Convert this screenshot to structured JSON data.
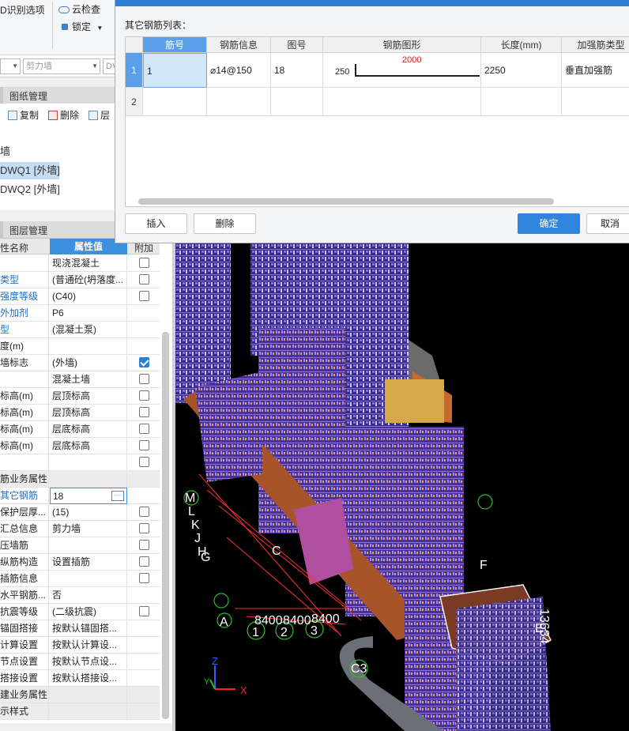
{
  "ribbon": {
    "recognize_label": "D识别选项",
    "cloud_check_label": "云检查",
    "lock_label": "锁定"
  },
  "combos": {
    "combo1_value": "",
    "combo2_value": "剪力墙",
    "combo3_value": "DV"
  },
  "drawing_panel": {
    "tab_label": "图纸管理",
    "toolbar": {
      "copy_label": "复制",
      "delete_label": "删除",
      "layer_label": "层"
    },
    "tree": [
      {
        "label": "墙",
        "selected": false
      },
      {
        "label": "DWQ1 [外墙]",
        "selected": true
      },
      {
        "label": "DWQ2 [外墙]",
        "selected": false
      }
    ]
  },
  "layer_panel": {
    "tab_label": "图层管理"
  },
  "properties": {
    "header": {
      "name_label": "性名称",
      "value_label": "属性值",
      "add_label": "附加"
    },
    "rows": [
      {
        "name": "",
        "value": "现浇混凝土",
        "blue": false,
        "checkbox": true,
        "checked": false,
        "group": false
      },
      {
        "name": "类型",
        "value": "(普通砼(坍落度...",
        "blue": true,
        "checkbox": true,
        "checked": false,
        "group": false
      },
      {
        "name": "强度等级",
        "value": "(C40)",
        "blue": true,
        "checkbox": true,
        "checked": false,
        "group": false
      },
      {
        "name": "外加剂",
        "value": "P6",
        "blue": true,
        "checkbox": false,
        "checked": false,
        "group": false
      },
      {
        "name": "型",
        "value": "(混凝土泵)",
        "blue": true,
        "checkbox": false,
        "checked": false,
        "group": false
      },
      {
        "name": "度(m)",
        "value": "",
        "blue": false,
        "checkbox": false,
        "checked": false,
        "group": false
      },
      {
        "name": "墙标志",
        "value": "(外墙)",
        "blue": false,
        "checkbox": true,
        "checked": true,
        "group": false
      },
      {
        "name": "",
        "value": "混凝土墙",
        "blue": false,
        "checkbox": true,
        "checked": false,
        "group": false
      },
      {
        "name": "标高(m)",
        "value": "层顶标高",
        "blue": false,
        "checkbox": true,
        "checked": false,
        "group": false
      },
      {
        "name": "标高(m)",
        "value": "层顶标高",
        "blue": false,
        "checkbox": true,
        "checked": false,
        "group": false
      },
      {
        "name": "标高(m)",
        "value": "层底标高",
        "blue": false,
        "checkbox": true,
        "checked": false,
        "group": false
      },
      {
        "name": "标高(m)",
        "value": "层底标高",
        "blue": false,
        "checkbox": true,
        "checked": false,
        "group": false
      },
      {
        "name": "",
        "value": "",
        "blue": false,
        "checkbox": true,
        "checked": false,
        "group": false
      },
      {
        "name": "筋业务属性",
        "value": "",
        "blue": false,
        "checkbox": false,
        "checked": false,
        "group": true
      },
      {
        "name": "其它钢筋",
        "value": "18",
        "blue": true,
        "checkbox": false,
        "checked": false,
        "group": false,
        "editing": true
      },
      {
        "name": "保护层厚...",
        "value": "(15)",
        "blue": false,
        "checkbox": true,
        "checked": false,
        "group": false
      },
      {
        "name": "汇总信息",
        "value": "剪力墙",
        "blue": false,
        "checkbox": true,
        "checked": false,
        "group": false
      },
      {
        "name": "压墙筋",
        "value": "",
        "blue": false,
        "checkbox": true,
        "checked": false,
        "group": false
      },
      {
        "name": "纵筋构造",
        "value": "设置插筋",
        "blue": false,
        "checkbox": true,
        "checked": false,
        "group": false
      },
      {
        "name": "插筋信息",
        "value": "",
        "blue": false,
        "checkbox": true,
        "checked": false,
        "group": false
      },
      {
        "name": "水平钢筋...",
        "value": "否",
        "blue": false,
        "checkbox": false,
        "checked": false,
        "group": false
      },
      {
        "name": "抗震等级",
        "value": "(二级抗震)",
        "blue": false,
        "checkbox": true,
        "checked": false,
        "group": false
      },
      {
        "name": "锚固搭接",
        "value": "按默认锚固搭...",
        "blue": false,
        "checkbox": false,
        "checked": false,
        "group": false
      },
      {
        "name": "计算设置",
        "value": "按默认计算设...",
        "blue": false,
        "checkbox": false,
        "checked": false,
        "group": false
      },
      {
        "name": "节点设置",
        "value": "按默认节点设...",
        "blue": false,
        "checkbox": false,
        "checked": false,
        "group": false
      },
      {
        "name": "搭接设置",
        "value": "按默认搭接设...",
        "blue": false,
        "checkbox": false,
        "checked": false,
        "group": false
      },
      {
        "name": "建业务属性",
        "value": "",
        "blue": false,
        "checkbox": false,
        "checked": false,
        "group": true
      },
      {
        "name": "示样式",
        "value": "",
        "blue": false,
        "checkbox": false,
        "checked": false,
        "group": true
      }
    ]
  },
  "dialog": {
    "caption": "其它钢筋列表：",
    "columns": [
      "筋号",
      "钢筋信息",
      "图号",
      "钢筋图形",
      "长度(mm)",
      "加强筋类型"
    ],
    "rows": [
      {
        "num": "1",
        "bar_no": "1",
        "info": "⌀14@150",
        "fig_no": "18",
        "shape_left": "250",
        "shape_top": "2000",
        "length": "2250",
        "type": "垂直加强筋"
      },
      {
        "num": "2",
        "bar_no": "",
        "info": "",
        "fig_no": "",
        "shape_left": "",
        "shape_top": "",
        "length": "",
        "type": ""
      }
    ],
    "insert_label": "插入",
    "delete_label": "删除",
    "ok_label": "确定",
    "cancel_label": "取消"
  },
  "view3d": {
    "axis_labels": [
      "8400",
      "8400",
      "8400",
      "1",
      "2",
      "3",
      "13634",
      "C3",
      "C",
      "A",
      "M",
      "L",
      "K",
      "J",
      "H",
      "G",
      "F",
      "E"
    ],
    "axis_z": "Z",
    "axis_x": "X",
    "axis_y": "Y"
  }
}
